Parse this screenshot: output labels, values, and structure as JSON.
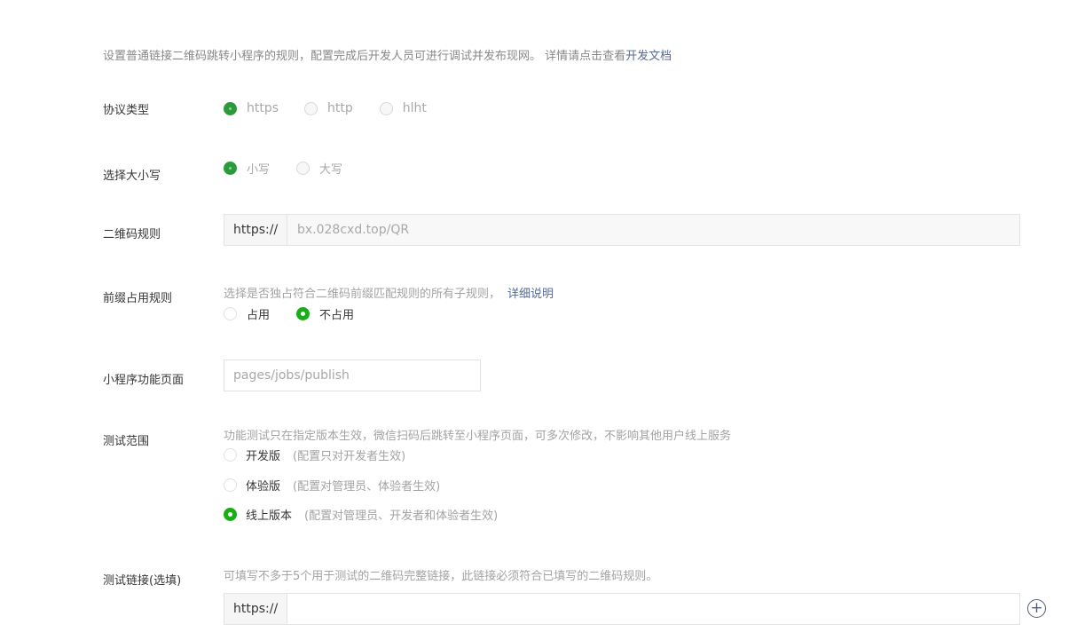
{
  "intro": {
    "text": "设置普通链接二维码跳转小程序的规则，配置完成后开发人员可进行调试并发布现网。 详情请点击查看",
    "link": "开发文档"
  },
  "protocol": {
    "label": "协议类型",
    "options": [
      "https",
      "http",
      "hlht"
    ],
    "selected": "https"
  },
  "case": {
    "label": "选择大小写",
    "options": [
      "小写",
      "大写"
    ],
    "selected": "小写"
  },
  "qr_rule": {
    "label": "二维码规则",
    "prefix": "https://",
    "value": "bx.028cxd.top/QR"
  },
  "prefix_rule": {
    "label": "前缀占用规则",
    "hint": "选择是否独占符合二维码前缀匹配规则的所有子规则，",
    "hint_link": "详细说明",
    "options": [
      "占用",
      "不占用"
    ],
    "selected": "不占用"
  },
  "page": {
    "label": "小程序功能页面",
    "placeholder": "pages/jobs/publish"
  },
  "scope": {
    "label": "测试范围",
    "hint": "功能测试只在指定版本生效，微信扫码后跳转至小程序页面，可多次修改，不影响其他用户线上服务",
    "options": [
      {
        "name": "开发版",
        "note": "(配置只对开发者生效)"
      },
      {
        "name": "体验版",
        "note": "(配置对管理员、体验者生效)"
      },
      {
        "name": "线上版本",
        "note": "(配置对管理员、开发者和体验者生效)"
      }
    ],
    "selected": "线上版本"
  },
  "test_link": {
    "label": "测试链接(选填)",
    "hint": "可填写不多于5个用于测试的二维码完整链接，此链接必须符合已填写的二维码规则。",
    "prefix": "https://",
    "value": "",
    "add_symbol": "+"
  },
  "colors": {
    "link": "#576b95",
    "radio_selected": "#1aad19",
    "radio_selected_dark": "#2a9a3a"
  }
}
